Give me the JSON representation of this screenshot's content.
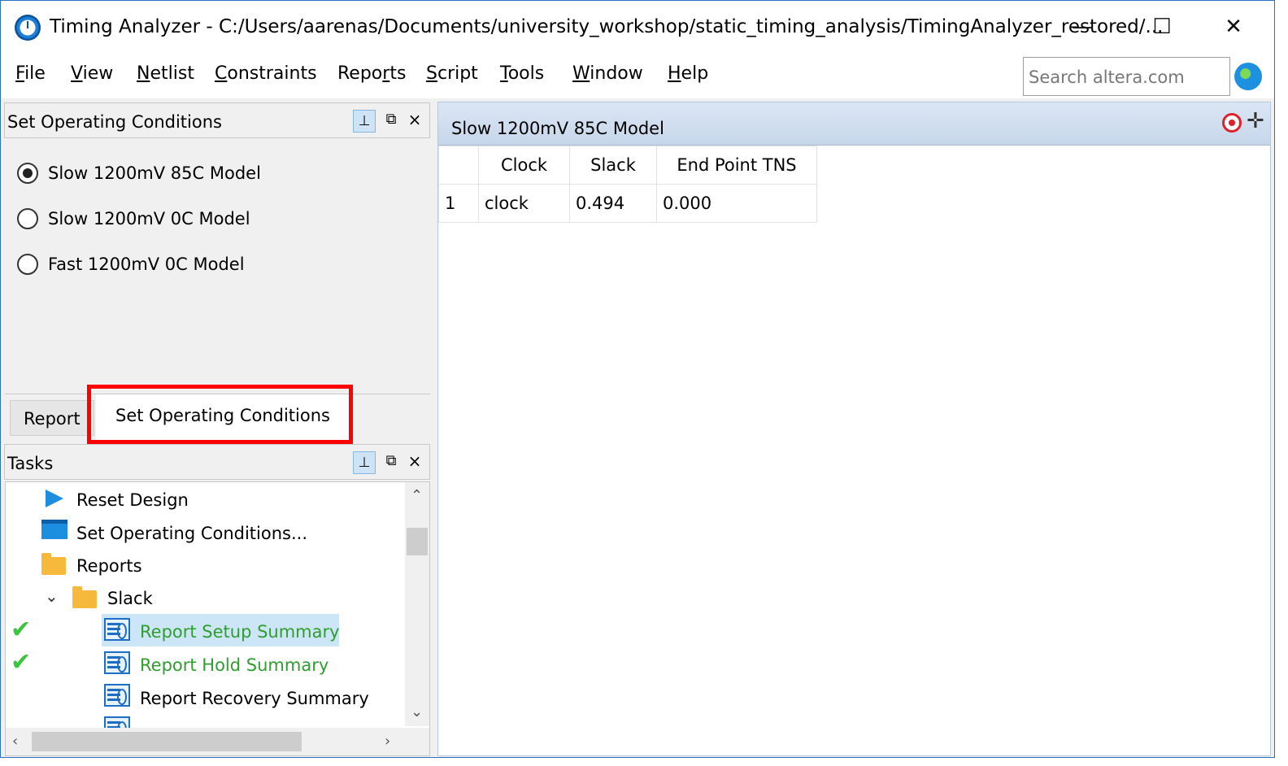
{
  "window": {
    "title": "Timing Analyzer - C:/Users/aarenas/Documents/university_workshop/static_timing_analysis/TimingAnalyzer_restored/...",
    "controls": {
      "minimize": "—",
      "maximize": "☐",
      "close": "✕"
    }
  },
  "menu": {
    "items": [
      {
        "u": "F",
        "rest": "ile"
      },
      {
        "u": "V",
        "rest": "iew"
      },
      {
        "u": "N",
        "rest": "etlist"
      },
      {
        "u": "C",
        "rest": "onstraints"
      },
      {
        "pre": "Repo",
        "u": "r",
        "rest": "ts"
      },
      {
        "u": "S",
        "rest": "cript"
      },
      {
        "u": "T",
        "rest": "ools"
      },
      {
        "u": "W",
        "rest": "indow"
      },
      {
        "u": "H",
        "rest": "elp"
      }
    ],
    "search_placeholder": "Search altera.com"
  },
  "operating_conditions_panel": {
    "title": "Set Operating Conditions",
    "options": [
      {
        "label": "Slow 1200mV 85C Model",
        "selected": true
      },
      {
        "label": "Slow 1200mV 0C Model",
        "selected": false
      },
      {
        "label": "Fast 1200mV 0C Model",
        "selected": false
      }
    ],
    "tabs": {
      "report": "Report",
      "active": "Set Operating Conditions"
    }
  },
  "tasks_panel": {
    "title": "Tasks",
    "items": [
      {
        "label": "Reset Design",
        "icon": "play-icon"
      },
      {
        "label": "Set Operating Conditions...",
        "icon": "calendar-icon"
      },
      {
        "label": "Reports",
        "icon": "folder-icon"
      },
      {
        "label": "Slack",
        "icon": "folder-icon",
        "expanded": true
      },
      {
        "label": "Report Setup Summary",
        "icon": "report-icon",
        "done": true,
        "selected": true
      },
      {
        "label": "Report Hold Summary",
        "icon": "report-icon",
        "done": true
      },
      {
        "label": "Report Recovery Summary",
        "icon": "report-icon",
        "done": false
      }
    ]
  },
  "results_panel": {
    "title": "Slow 1200mV 85C Model",
    "columns": [
      "",
      "Clock",
      "Slack",
      "End Point TNS"
    ],
    "rows": [
      [
        "1",
        "clock",
        "0.494",
        "0.000"
      ]
    ]
  },
  "colors": {
    "highlight_box": "#ff0000",
    "done_text": "#2e9e2e",
    "selection": "#cde6f7"
  }
}
